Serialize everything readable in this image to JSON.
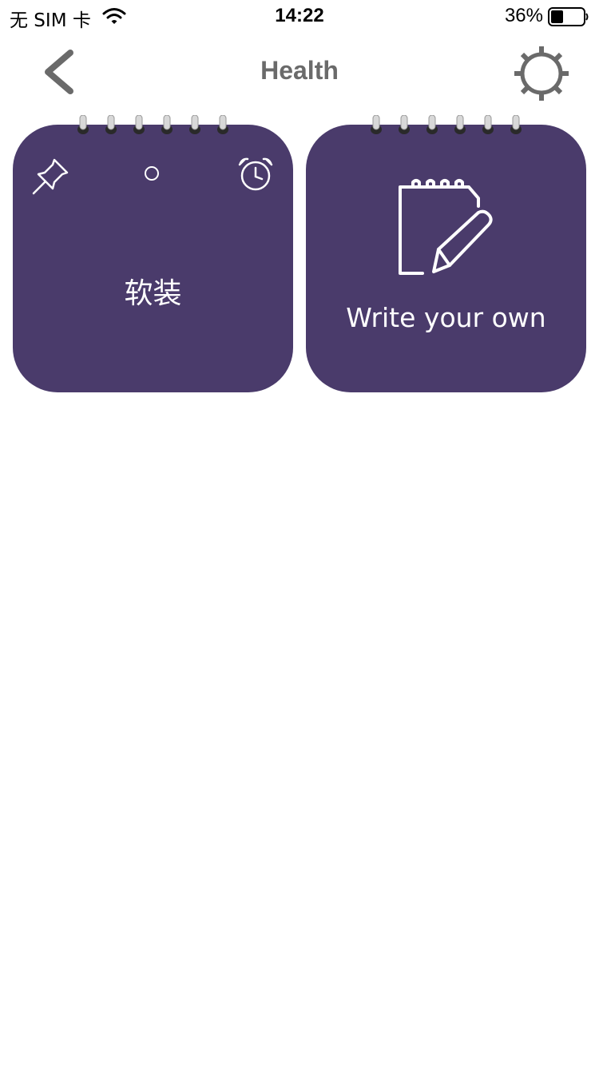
{
  "status_bar": {
    "carrier": "无 SIM 卡",
    "time": "14:22",
    "battery_percent": "36%"
  },
  "nav": {
    "title": "Health",
    "back_icon": "chevron-left-icon",
    "settings_icon": "gear-icon"
  },
  "cards": [
    {
      "title": "软装",
      "icons": [
        "pin-icon",
        "dot-indicator",
        "alarm-clock-icon"
      ]
    },
    {
      "title": "Write your own",
      "icons": [
        "notepad-pencil-icon"
      ]
    }
  ],
  "colors": {
    "card_background": "#4a3b6b",
    "nav_gray": "#6a6a6a",
    "text_on_card": "#ffffff"
  }
}
